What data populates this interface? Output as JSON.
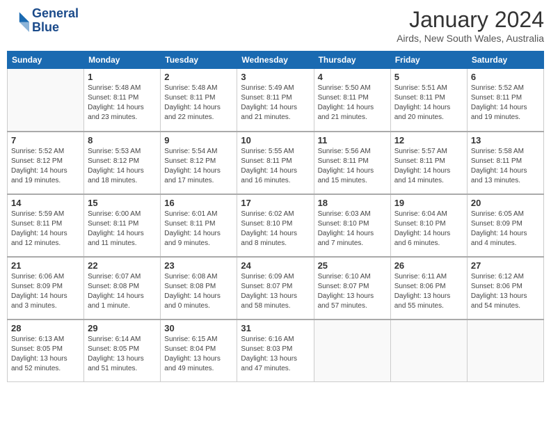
{
  "logo": {
    "line1": "General",
    "line2": "Blue"
  },
  "title": "January 2024",
  "location": "Airds, New South Wales, Australia",
  "days_of_week": [
    "Sunday",
    "Monday",
    "Tuesday",
    "Wednesday",
    "Thursday",
    "Friday",
    "Saturday"
  ],
  "weeks": [
    [
      {
        "day": "",
        "info": ""
      },
      {
        "day": "1",
        "info": "Sunrise: 5:48 AM\nSunset: 8:11 PM\nDaylight: 14 hours\nand 23 minutes."
      },
      {
        "day": "2",
        "info": "Sunrise: 5:48 AM\nSunset: 8:11 PM\nDaylight: 14 hours\nand 22 minutes."
      },
      {
        "day": "3",
        "info": "Sunrise: 5:49 AM\nSunset: 8:11 PM\nDaylight: 14 hours\nand 21 minutes."
      },
      {
        "day": "4",
        "info": "Sunrise: 5:50 AM\nSunset: 8:11 PM\nDaylight: 14 hours\nand 21 minutes."
      },
      {
        "day": "5",
        "info": "Sunrise: 5:51 AM\nSunset: 8:11 PM\nDaylight: 14 hours\nand 20 minutes."
      },
      {
        "day": "6",
        "info": "Sunrise: 5:52 AM\nSunset: 8:11 PM\nDaylight: 14 hours\nand 19 minutes."
      }
    ],
    [
      {
        "day": "7",
        "info": "Sunrise: 5:52 AM\nSunset: 8:12 PM\nDaylight: 14 hours\nand 19 minutes."
      },
      {
        "day": "8",
        "info": "Sunrise: 5:53 AM\nSunset: 8:12 PM\nDaylight: 14 hours\nand 18 minutes."
      },
      {
        "day": "9",
        "info": "Sunrise: 5:54 AM\nSunset: 8:12 PM\nDaylight: 14 hours\nand 17 minutes."
      },
      {
        "day": "10",
        "info": "Sunrise: 5:55 AM\nSunset: 8:11 PM\nDaylight: 14 hours\nand 16 minutes."
      },
      {
        "day": "11",
        "info": "Sunrise: 5:56 AM\nSunset: 8:11 PM\nDaylight: 14 hours\nand 15 minutes."
      },
      {
        "day": "12",
        "info": "Sunrise: 5:57 AM\nSunset: 8:11 PM\nDaylight: 14 hours\nand 14 minutes."
      },
      {
        "day": "13",
        "info": "Sunrise: 5:58 AM\nSunset: 8:11 PM\nDaylight: 14 hours\nand 13 minutes."
      }
    ],
    [
      {
        "day": "14",
        "info": "Sunrise: 5:59 AM\nSunset: 8:11 PM\nDaylight: 14 hours\nand 12 minutes."
      },
      {
        "day": "15",
        "info": "Sunrise: 6:00 AM\nSunset: 8:11 PM\nDaylight: 14 hours\nand 11 minutes."
      },
      {
        "day": "16",
        "info": "Sunrise: 6:01 AM\nSunset: 8:11 PM\nDaylight: 14 hours\nand 9 minutes."
      },
      {
        "day": "17",
        "info": "Sunrise: 6:02 AM\nSunset: 8:10 PM\nDaylight: 14 hours\nand 8 minutes."
      },
      {
        "day": "18",
        "info": "Sunrise: 6:03 AM\nSunset: 8:10 PM\nDaylight: 14 hours\nand 7 minutes."
      },
      {
        "day": "19",
        "info": "Sunrise: 6:04 AM\nSunset: 8:10 PM\nDaylight: 14 hours\nand 6 minutes."
      },
      {
        "day": "20",
        "info": "Sunrise: 6:05 AM\nSunset: 8:09 PM\nDaylight: 14 hours\nand 4 minutes."
      }
    ],
    [
      {
        "day": "21",
        "info": "Sunrise: 6:06 AM\nSunset: 8:09 PM\nDaylight: 14 hours\nand 3 minutes."
      },
      {
        "day": "22",
        "info": "Sunrise: 6:07 AM\nSunset: 8:08 PM\nDaylight: 14 hours\nand 1 minute."
      },
      {
        "day": "23",
        "info": "Sunrise: 6:08 AM\nSunset: 8:08 PM\nDaylight: 14 hours\nand 0 minutes."
      },
      {
        "day": "24",
        "info": "Sunrise: 6:09 AM\nSunset: 8:07 PM\nDaylight: 13 hours\nand 58 minutes."
      },
      {
        "day": "25",
        "info": "Sunrise: 6:10 AM\nSunset: 8:07 PM\nDaylight: 13 hours\nand 57 minutes."
      },
      {
        "day": "26",
        "info": "Sunrise: 6:11 AM\nSunset: 8:06 PM\nDaylight: 13 hours\nand 55 minutes."
      },
      {
        "day": "27",
        "info": "Sunrise: 6:12 AM\nSunset: 8:06 PM\nDaylight: 13 hours\nand 54 minutes."
      }
    ],
    [
      {
        "day": "28",
        "info": "Sunrise: 6:13 AM\nSunset: 8:05 PM\nDaylight: 13 hours\nand 52 minutes."
      },
      {
        "day": "29",
        "info": "Sunrise: 6:14 AM\nSunset: 8:05 PM\nDaylight: 13 hours\nand 51 minutes."
      },
      {
        "day": "30",
        "info": "Sunrise: 6:15 AM\nSunset: 8:04 PM\nDaylight: 13 hours\nand 49 minutes."
      },
      {
        "day": "31",
        "info": "Sunrise: 6:16 AM\nSunset: 8:03 PM\nDaylight: 13 hours\nand 47 minutes."
      },
      {
        "day": "",
        "info": ""
      },
      {
        "day": "",
        "info": ""
      },
      {
        "day": "",
        "info": ""
      }
    ]
  ]
}
